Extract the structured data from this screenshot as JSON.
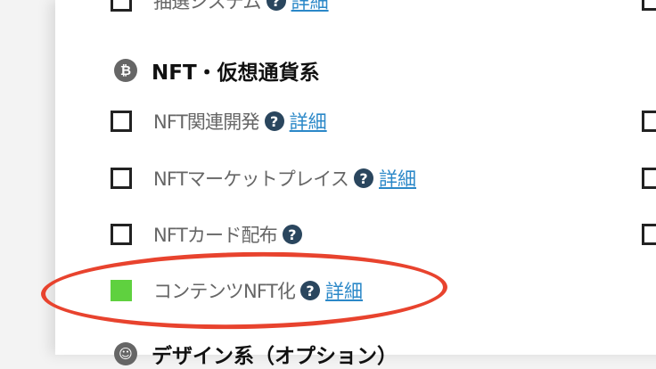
{
  "top_row": {
    "label": "抽選システム",
    "help": "?",
    "detail": "詳細"
  },
  "nft_section": {
    "icon": "₿",
    "title": "NFT・仮想通貨系",
    "items": [
      {
        "label": "NFT関連開発",
        "help": "?",
        "detail": "詳細",
        "checked": false
      },
      {
        "label": "NFTマーケットプレイス",
        "help": "?",
        "detail": "詳細",
        "checked": false
      },
      {
        "label": "NFTカード配布",
        "help": "?",
        "checked": false
      },
      {
        "label": "コンテンツNFT化",
        "help": "?",
        "detail": "詳細",
        "checked": true
      }
    ]
  },
  "design_section": {
    "icon": "☺",
    "title": "デザイン系（オプション）"
  },
  "colors": {
    "checked": "#5fd13f",
    "help_icon": "#2a465e",
    "link": "#2b88c8",
    "highlight": "#e8432e"
  }
}
